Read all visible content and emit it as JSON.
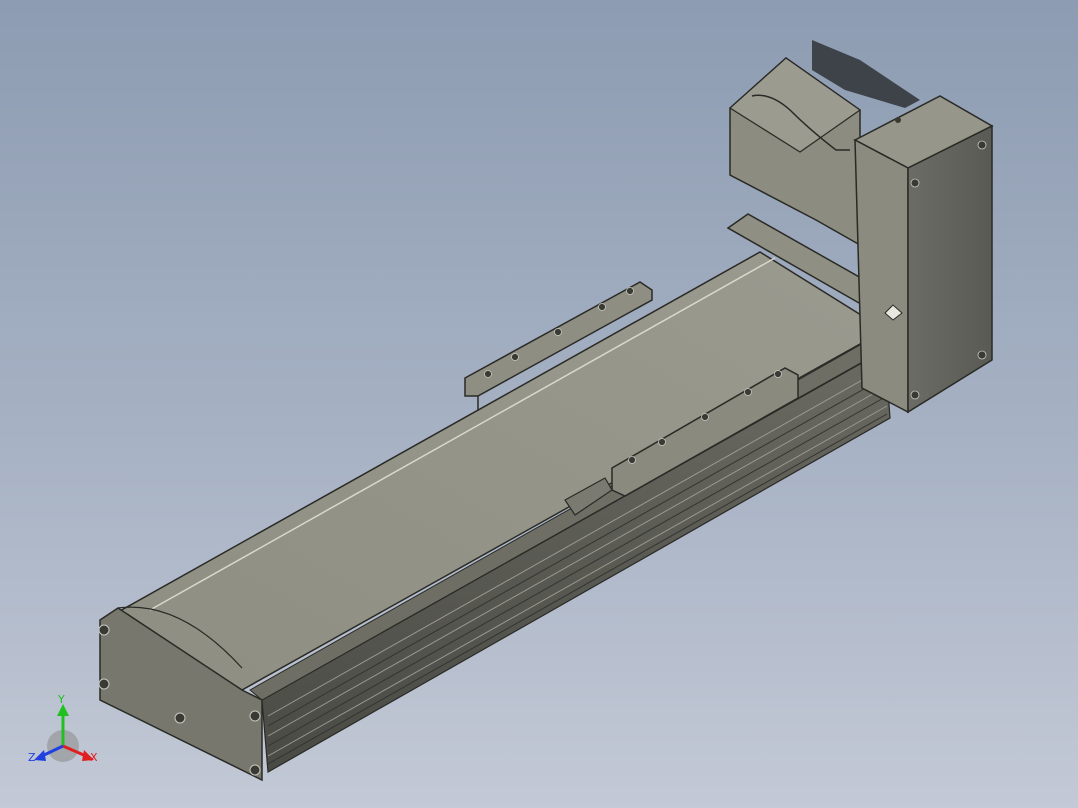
{
  "viewport": {
    "background_top": "#8d9cb2",
    "background_bottom": "#c3c9d6",
    "model_shade": "#8b8b7e"
  },
  "triad": {
    "x_label": "X",
    "y_label": "Y",
    "z_label": "Z",
    "x_color": "#e02020",
    "y_color": "#20c020",
    "z_color": "#2040e0"
  }
}
